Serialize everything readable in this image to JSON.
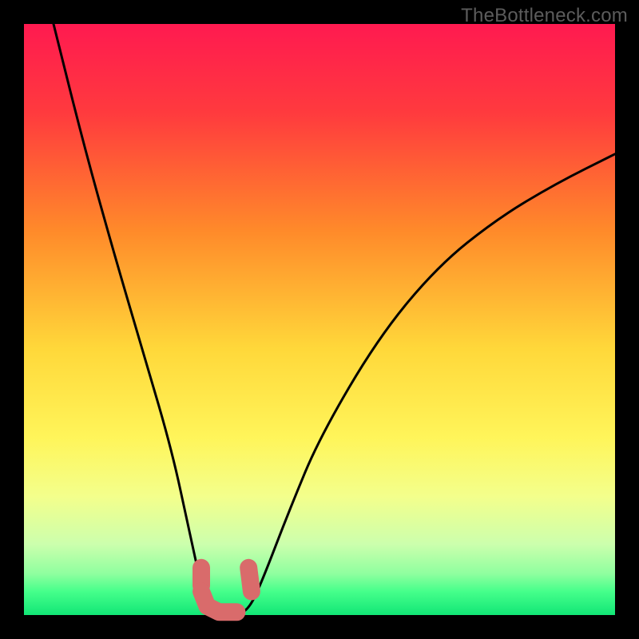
{
  "watermark": "TheBottleneck.com",
  "chart_data": {
    "type": "line",
    "title": "",
    "xlabel": "",
    "ylabel": "",
    "xlim": [
      0,
      100
    ],
    "ylim": [
      0,
      100
    ],
    "grid": false,
    "legend": false,
    "series": [
      {
        "name": "bottleneck-curve",
        "points": [
          {
            "x": 5,
            "y": 100
          },
          {
            "x": 10,
            "y": 80
          },
          {
            "x": 15,
            "y": 62
          },
          {
            "x": 20,
            "y": 45
          },
          {
            "x": 25,
            "y": 28
          },
          {
            "x": 28,
            "y": 14
          },
          {
            "x": 30,
            "y": 5
          },
          {
            "x": 32,
            "y": 1
          },
          {
            "x": 34,
            "y": 0
          },
          {
            "x": 36,
            "y": 0
          },
          {
            "x": 38,
            "y": 1
          },
          {
            "x": 40,
            "y": 5
          },
          {
            "x": 45,
            "y": 18
          },
          {
            "x": 50,
            "y": 30
          },
          {
            "x": 60,
            "y": 47
          },
          {
            "x": 70,
            "y": 59
          },
          {
            "x": 80,
            "y": 67
          },
          {
            "x": 90,
            "y": 73
          },
          {
            "x": 100,
            "y": 78
          }
        ]
      }
    ],
    "highlight_segments": [
      {
        "name": "left-dot",
        "points": [
          {
            "x": 30,
            "y": 8
          },
          {
            "x": 30,
            "y": 5
          }
        ]
      },
      {
        "name": "left-elbow",
        "points": [
          {
            "x": 30,
            "y": 4
          },
          {
            "x": 31,
            "y": 1.5
          },
          {
            "x": 33,
            "y": 0.5
          },
          {
            "x": 36,
            "y": 0.5
          }
        ]
      },
      {
        "name": "right-dot",
        "points": [
          {
            "x": 38,
            "y": 8
          },
          {
            "x": 38.5,
            "y": 4
          }
        ]
      }
    ],
    "gradient_stops": [
      {
        "offset": 0.0,
        "color": "#ff1a50"
      },
      {
        "offset": 0.15,
        "color": "#ff3a3e"
      },
      {
        "offset": 0.35,
        "color": "#ff8a2a"
      },
      {
        "offset": 0.55,
        "color": "#ffd83a"
      },
      {
        "offset": 0.7,
        "color": "#fff55a"
      },
      {
        "offset": 0.8,
        "color": "#f3ff8c"
      },
      {
        "offset": 0.88,
        "color": "#ccffad"
      },
      {
        "offset": 0.93,
        "color": "#8fff9f"
      },
      {
        "offset": 0.96,
        "color": "#46ff8b"
      },
      {
        "offset": 1.0,
        "color": "#12e676"
      }
    ]
  }
}
